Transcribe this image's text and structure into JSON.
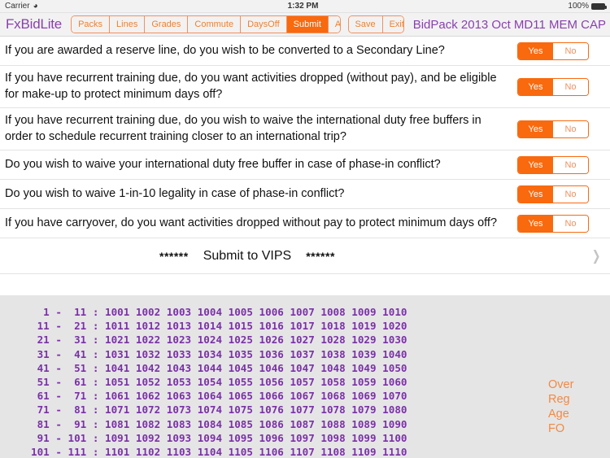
{
  "status_bar": {
    "carrier": "Carrier",
    "wifi_icon": "wifi-icon",
    "time": "1:32 PM",
    "battery_pct": "100%",
    "battery_icon": "battery-full-icon"
  },
  "toolbar": {
    "app_title": "FxBidLite",
    "nav_buttons": [
      {
        "label": "Packs",
        "active": false
      },
      {
        "label": "Lines",
        "active": false
      },
      {
        "label": "Grades",
        "active": false
      },
      {
        "label": "Commute",
        "active": false
      },
      {
        "label": "DaysOff",
        "active": false
      },
      {
        "label": "Submit",
        "active": true
      },
      {
        "label": "Awards+",
        "active": false
      }
    ],
    "action_buttons": [
      {
        "label": "Save"
      },
      {
        "label": "Exit"
      }
    ],
    "bidpack_title": "BidPack 2013 Oct MD11 MEM CAP"
  },
  "questions": [
    {
      "text": "If you are awarded a reserve line, do you wish to be converted to a Secondary Line?",
      "yes_label": "Yes",
      "no_label": "No",
      "selected": "Yes"
    },
    {
      "text": "If you have recurrent training due, do you want activities dropped (without pay), and be eligible for make-up to protect minimum days off?",
      "yes_label": "Yes",
      "no_label": "No",
      "selected": "Yes"
    },
    {
      "text": "If you have recurrent training due, do you wish to waive the international duty free buffers in order to schedule recurrent training closer to an international trip?",
      "yes_label": "Yes",
      "no_label": "No",
      "selected": "Yes"
    },
    {
      "text": "Do you wish to waive your international duty free buffer in case of phase-in conflict?",
      "yes_label": "Yes",
      "no_label": "No",
      "selected": "Yes"
    },
    {
      "text": "Do you wish to waive 1-in-10 legality in case of phase-in conflict?",
      "yes_label": "Yes",
      "no_label": "No",
      "selected": "Yes"
    },
    {
      "text": "If you have carryover, do you want activities dropped without pay to protect minimum days off?",
      "yes_label": "Yes",
      "no_label": "No",
      "selected": "Yes"
    }
  ],
  "submit_row": {
    "stars_left": "******",
    "label": "Submit to VIPS",
    "stars_right": "******",
    "chevron_icon": "chevron-right-icon"
  },
  "numbers_panel": {
    "lines": [
      "  1 -  11 : 1001 1002 1003 1004 1005 1006 1007 1008 1009 1010",
      " 11 -  21 : 1011 1012 1013 1014 1015 1016 1017 1018 1019 1020",
      " 21 -  31 : 1021 1022 1023 1024 1025 1026 1027 1028 1029 1030",
      " 31 -  41 : 1031 1032 1033 1034 1035 1036 1037 1038 1039 1040",
      " 41 -  51 : 1041 1042 1043 1044 1045 1046 1047 1048 1049 1050",
      " 51 -  61 : 1051 1052 1053 1054 1055 1056 1057 1058 1059 1060",
      " 61 -  71 : 1061 1062 1063 1064 1065 1066 1067 1068 1069 1070",
      " 71 -  81 : 1071 1072 1073 1074 1075 1076 1077 1078 1079 1080",
      " 81 -  91 : 1081 1082 1083 1084 1085 1086 1087 1088 1089 1090",
      " 91 - 101 : 1091 1092 1093 1094 1095 1096 1097 1098 1099 1100",
      "101 - 111 : 1101 1102 1103 1104 1105 1106 1107 1108 1109 1110"
    ],
    "side_labels": [
      "Over",
      "Reg",
      "Age",
      "FO"
    ]
  },
  "colors": {
    "accent_orange": "#f9690e",
    "brand_purple": "#8a3fb0",
    "number_purple": "#7b30a8",
    "panel_gray": "#e5e5e5",
    "toolbar_gray": "#f2f2f2"
  }
}
